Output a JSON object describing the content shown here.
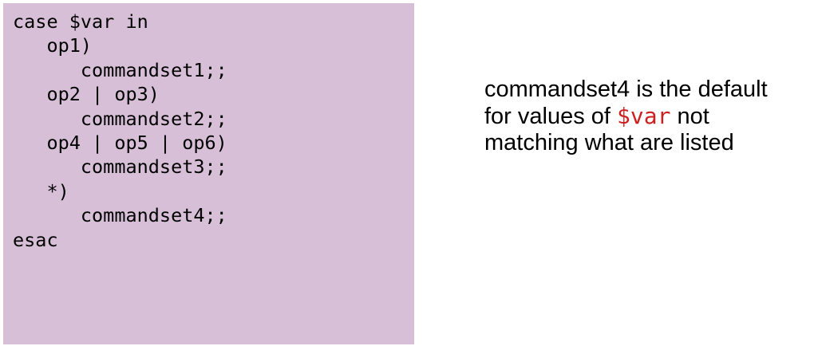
{
  "code_block": {
    "lines": [
      "case $var in",
      "   op1)",
      "      commandset1;;",
      "   op2 | op3)",
      "      commandset2;;",
      "   op4 | op5 | op6)",
      "      commandset3;;",
      "   *)",
      "      commandset4;;",
      "esac"
    ]
  },
  "note": {
    "line1": "commandset4 is the default",
    "line2_before": "for values of ",
    "line2_var": "$var",
    "line2_after": " not",
    "line3": "matching what are listed"
  },
  "colors": {
    "code_background": "#d8bfd8",
    "var_highlight": "#cc1f1f"
  }
}
